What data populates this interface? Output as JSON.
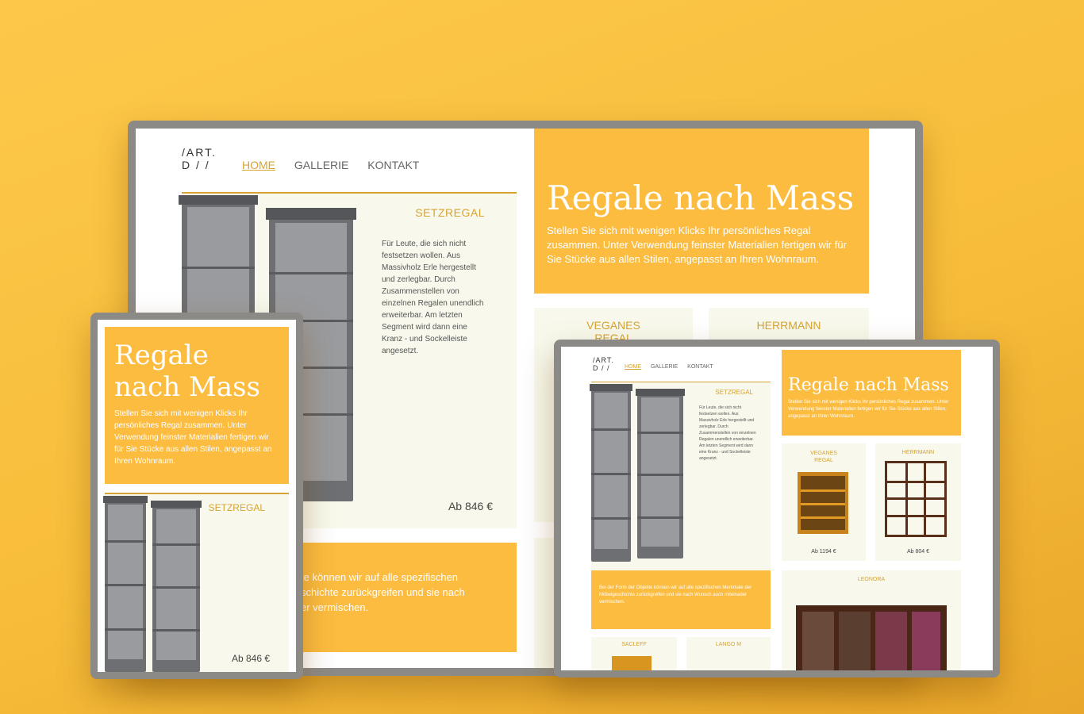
{
  "brand": {
    "line1": "/ART.",
    "line2": "D / /"
  },
  "nav": {
    "home": "HOME",
    "gallery": "GALLERIE",
    "contact": "KONTAKT"
  },
  "hero": {
    "title": "Regale nach Mass",
    "text": "Stellen Sie sich mit wenigen Klicks Ihr persönliches Regal zusammen. Unter Verwendung feinster Materialien fertigen wir für Sie Stücke aus allen Stilen, angepasst an Ihren Wohnraum."
  },
  "featured": {
    "name": "SETZREGAL",
    "description": "Für Leute, die sich nicht festsetzen wollen. Aus Massivholz Erle hergestellt und zerlegbar. Durch Zusammenstellen von einzelnen Regalen unendlich erweiterbar. Am letzten Segment wird dann eine Kranz - und Sockelleiste angesetzt.",
    "price": "Ab 846 €"
  },
  "info": {
    "text": "Bei der Form der Objekte können wir auf alle spezifischen Merkmale der Möbelgeschichte zurückgreifen und sie nach Wunsch auch miteinader vermischen.",
    "desktop_line1": "te können wir auf alle spezifischen",
    "desktop_line2": "schichte zurückgreifen und sie nach",
    "desktop_line3": "er vermischen."
  },
  "products": {
    "vegan": {
      "name": "VEGANES REGAL",
      "price": "Ab 1194 €"
    },
    "herrmann": {
      "name": "HERRMANN",
      "price": "Ab 804 €"
    },
    "leonora": {
      "name": "LEONORA"
    },
    "sacleff": {
      "name": "SACLEFF"
    },
    "lango": {
      "name": "LANGO M"
    }
  },
  "colors": {
    "accent": "#fbbc40",
    "gold": "#d6a432",
    "cream": "#f8f9ec",
    "frame": "#8c8a86"
  }
}
